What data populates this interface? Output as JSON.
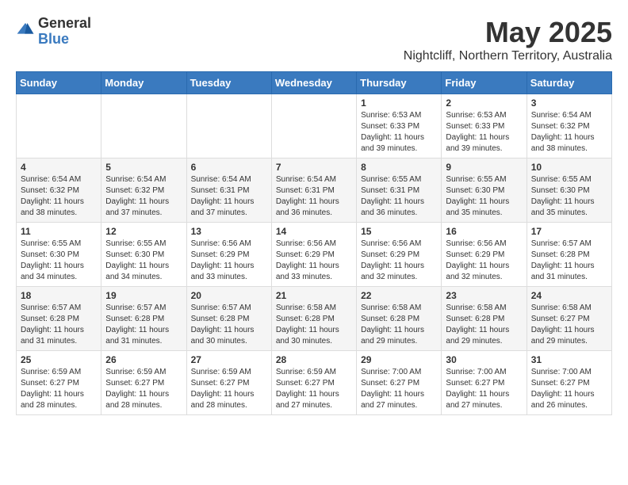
{
  "header": {
    "logo_general": "General",
    "logo_blue": "Blue",
    "title": "May 2025",
    "subtitle": "Nightcliff, Northern Territory, Australia"
  },
  "calendar": {
    "days": [
      "Sunday",
      "Monday",
      "Tuesday",
      "Wednesday",
      "Thursday",
      "Friday",
      "Saturday"
    ],
    "rows": [
      [
        {
          "date": "",
          "info": ""
        },
        {
          "date": "",
          "info": ""
        },
        {
          "date": "",
          "info": ""
        },
        {
          "date": "",
          "info": ""
        },
        {
          "date": "1",
          "info": "Sunrise: 6:53 AM\nSunset: 6:33 PM\nDaylight: 11 hours and 39 minutes."
        },
        {
          "date": "2",
          "info": "Sunrise: 6:53 AM\nSunset: 6:33 PM\nDaylight: 11 hours and 39 minutes."
        },
        {
          "date": "3",
          "info": "Sunrise: 6:54 AM\nSunset: 6:32 PM\nDaylight: 11 hours and 38 minutes."
        }
      ],
      [
        {
          "date": "4",
          "info": "Sunrise: 6:54 AM\nSunset: 6:32 PM\nDaylight: 11 hours and 38 minutes."
        },
        {
          "date": "5",
          "info": "Sunrise: 6:54 AM\nSunset: 6:32 PM\nDaylight: 11 hours and 37 minutes."
        },
        {
          "date": "6",
          "info": "Sunrise: 6:54 AM\nSunset: 6:31 PM\nDaylight: 11 hours and 37 minutes."
        },
        {
          "date": "7",
          "info": "Sunrise: 6:54 AM\nSunset: 6:31 PM\nDaylight: 11 hours and 36 minutes."
        },
        {
          "date": "8",
          "info": "Sunrise: 6:55 AM\nSunset: 6:31 PM\nDaylight: 11 hours and 36 minutes."
        },
        {
          "date": "9",
          "info": "Sunrise: 6:55 AM\nSunset: 6:30 PM\nDaylight: 11 hours and 35 minutes."
        },
        {
          "date": "10",
          "info": "Sunrise: 6:55 AM\nSunset: 6:30 PM\nDaylight: 11 hours and 35 minutes."
        }
      ],
      [
        {
          "date": "11",
          "info": "Sunrise: 6:55 AM\nSunset: 6:30 PM\nDaylight: 11 hours and 34 minutes."
        },
        {
          "date": "12",
          "info": "Sunrise: 6:55 AM\nSunset: 6:30 PM\nDaylight: 11 hours and 34 minutes."
        },
        {
          "date": "13",
          "info": "Sunrise: 6:56 AM\nSunset: 6:29 PM\nDaylight: 11 hours and 33 minutes."
        },
        {
          "date": "14",
          "info": "Sunrise: 6:56 AM\nSunset: 6:29 PM\nDaylight: 11 hours and 33 minutes."
        },
        {
          "date": "15",
          "info": "Sunrise: 6:56 AM\nSunset: 6:29 PM\nDaylight: 11 hours and 32 minutes."
        },
        {
          "date": "16",
          "info": "Sunrise: 6:56 AM\nSunset: 6:29 PM\nDaylight: 11 hours and 32 minutes."
        },
        {
          "date": "17",
          "info": "Sunrise: 6:57 AM\nSunset: 6:28 PM\nDaylight: 11 hours and 31 minutes."
        }
      ],
      [
        {
          "date": "18",
          "info": "Sunrise: 6:57 AM\nSunset: 6:28 PM\nDaylight: 11 hours and 31 minutes."
        },
        {
          "date": "19",
          "info": "Sunrise: 6:57 AM\nSunset: 6:28 PM\nDaylight: 11 hours and 31 minutes."
        },
        {
          "date": "20",
          "info": "Sunrise: 6:57 AM\nSunset: 6:28 PM\nDaylight: 11 hours and 30 minutes."
        },
        {
          "date": "21",
          "info": "Sunrise: 6:58 AM\nSunset: 6:28 PM\nDaylight: 11 hours and 30 minutes."
        },
        {
          "date": "22",
          "info": "Sunrise: 6:58 AM\nSunset: 6:28 PM\nDaylight: 11 hours and 29 minutes."
        },
        {
          "date": "23",
          "info": "Sunrise: 6:58 AM\nSunset: 6:28 PM\nDaylight: 11 hours and 29 minutes."
        },
        {
          "date": "24",
          "info": "Sunrise: 6:58 AM\nSunset: 6:27 PM\nDaylight: 11 hours and 29 minutes."
        }
      ],
      [
        {
          "date": "25",
          "info": "Sunrise: 6:59 AM\nSunset: 6:27 PM\nDaylight: 11 hours and 28 minutes."
        },
        {
          "date": "26",
          "info": "Sunrise: 6:59 AM\nSunset: 6:27 PM\nDaylight: 11 hours and 28 minutes."
        },
        {
          "date": "27",
          "info": "Sunrise: 6:59 AM\nSunset: 6:27 PM\nDaylight: 11 hours and 28 minutes."
        },
        {
          "date": "28",
          "info": "Sunrise: 6:59 AM\nSunset: 6:27 PM\nDaylight: 11 hours and 27 minutes."
        },
        {
          "date": "29",
          "info": "Sunrise: 7:00 AM\nSunset: 6:27 PM\nDaylight: 11 hours and 27 minutes."
        },
        {
          "date": "30",
          "info": "Sunrise: 7:00 AM\nSunset: 6:27 PM\nDaylight: 11 hours and 27 minutes."
        },
        {
          "date": "31",
          "info": "Sunrise: 7:00 AM\nSunset: 6:27 PM\nDaylight: 11 hours and 26 minutes."
        }
      ]
    ]
  }
}
